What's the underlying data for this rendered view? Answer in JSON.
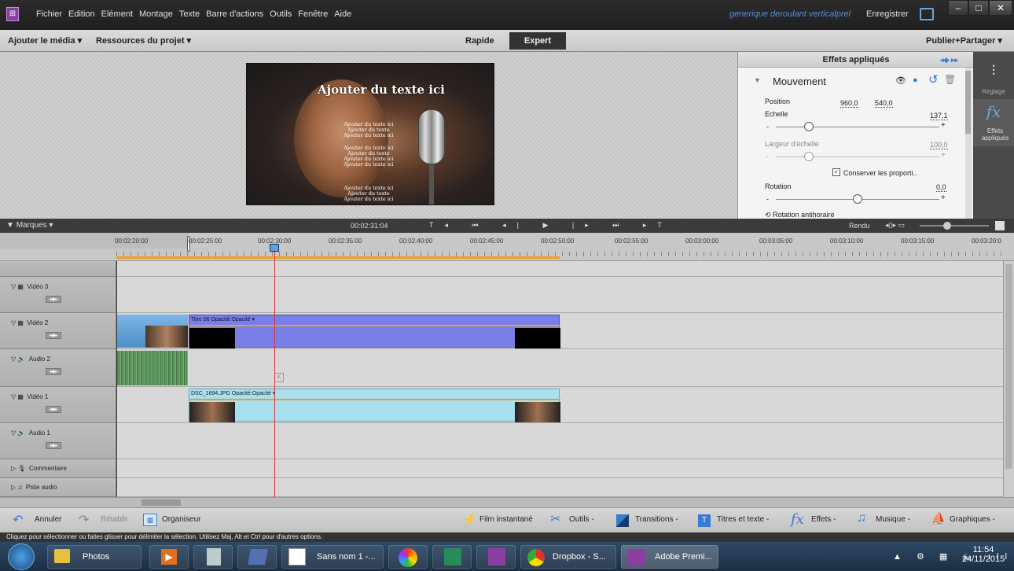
{
  "titlebar": {
    "menu": [
      "Fichier",
      "Edition",
      "Elément",
      "Montage",
      "Texte",
      "Barre d'actions",
      "Outils",
      "Fenêtre",
      "Aide"
    ],
    "project_title": "generique deroulant verticalprel",
    "save": "Enregistrer"
  },
  "toolbar": {
    "add_media": "Ajouter le média",
    "project_assets": "Ressources du projet",
    "mode_quick": "Rapide",
    "mode_expert": "Expert",
    "publish": "Publier+Partager"
  },
  "preview": {
    "big_text": "Ajouter du texte ici",
    "line_a": "Ajouter du texte ici",
    "line_b": "Ajouter du texte",
    "line_c": "Ajouter du texte ici"
  },
  "effects": {
    "title": "Effets appliqués",
    "section": "Mouvement",
    "position_label": "Position",
    "position_x": "960,0",
    "position_y": "540,0",
    "scale_label": "Echelle",
    "scale_value": "137,1",
    "scale_width_label": "Largeur d'échelle",
    "scale_width_value": "100,0",
    "keep_proportions": "Conserver les proporti..",
    "rotation_label": "Rotation",
    "rotation_value": "0,0",
    "rotation_ccw": "Rotation antihoraire",
    "scale_level": 0.2,
    "scale_width_level": 0.2,
    "rotation_level": 0.5
  },
  "side": {
    "adjust": "Réglage",
    "applied_effects": "Effets appliqués"
  },
  "timeline": {
    "markers": "Marques",
    "timecode": "00:02:31:04",
    "render": "Rendu",
    "ruler": [
      "00:02:20:00",
      "00:02:25:00",
      "00:02:30:00",
      "00:02:35:00",
      "00:02:40:00",
      "00:02:45:00",
      "00:02:50:00",
      "00:02:55:00",
      "00:03:00:00",
      "00:03:05:00",
      "00:03:10:00",
      "00:03:15:00",
      "00:03:20:0"
    ],
    "tracks": {
      "video3": "Vidéo 3",
      "video2": "Vidéo 2",
      "audio2": "Audio 2",
      "video1": "Vidéo 1",
      "audio1": "Audio 1",
      "comment": "Commentaire",
      "soundtrack": "Piste audio"
    },
    "clip_title": "Titre 06  Opacité:Opacité ▾",
    "clip_photo": "DSC_1694.JPG  Opacité:Opacité ▾"
  },
  "bottombar": {
    "undo": "Annuler",
    "redo": "Rétablir",
    "organizer": "Organiseur",
    "instant_movie": "Film instantané",
    "tools": "Outils",
    "transitions": "Transitions",
    "titles": "Titres et texte",
    "effects": "Effets",
    "music": "Musique",
    "graphics": "Graphiques"
  },
  "status": "Cliquez pour sélectionner ou faites glisser pour délimiter la sélection. Utilisez Maj, Alt et Ctrl pour d'autres options.",
  "taskbar": {
    "photos": "Photos",
    "untitled": "Sans nom 1 -...",
    "dropbox": "Dropbox - S...",
    "premiere": "Adobe Premi...",
    "time": "11:54",
    "date": "24/11/2015"
  }
}
